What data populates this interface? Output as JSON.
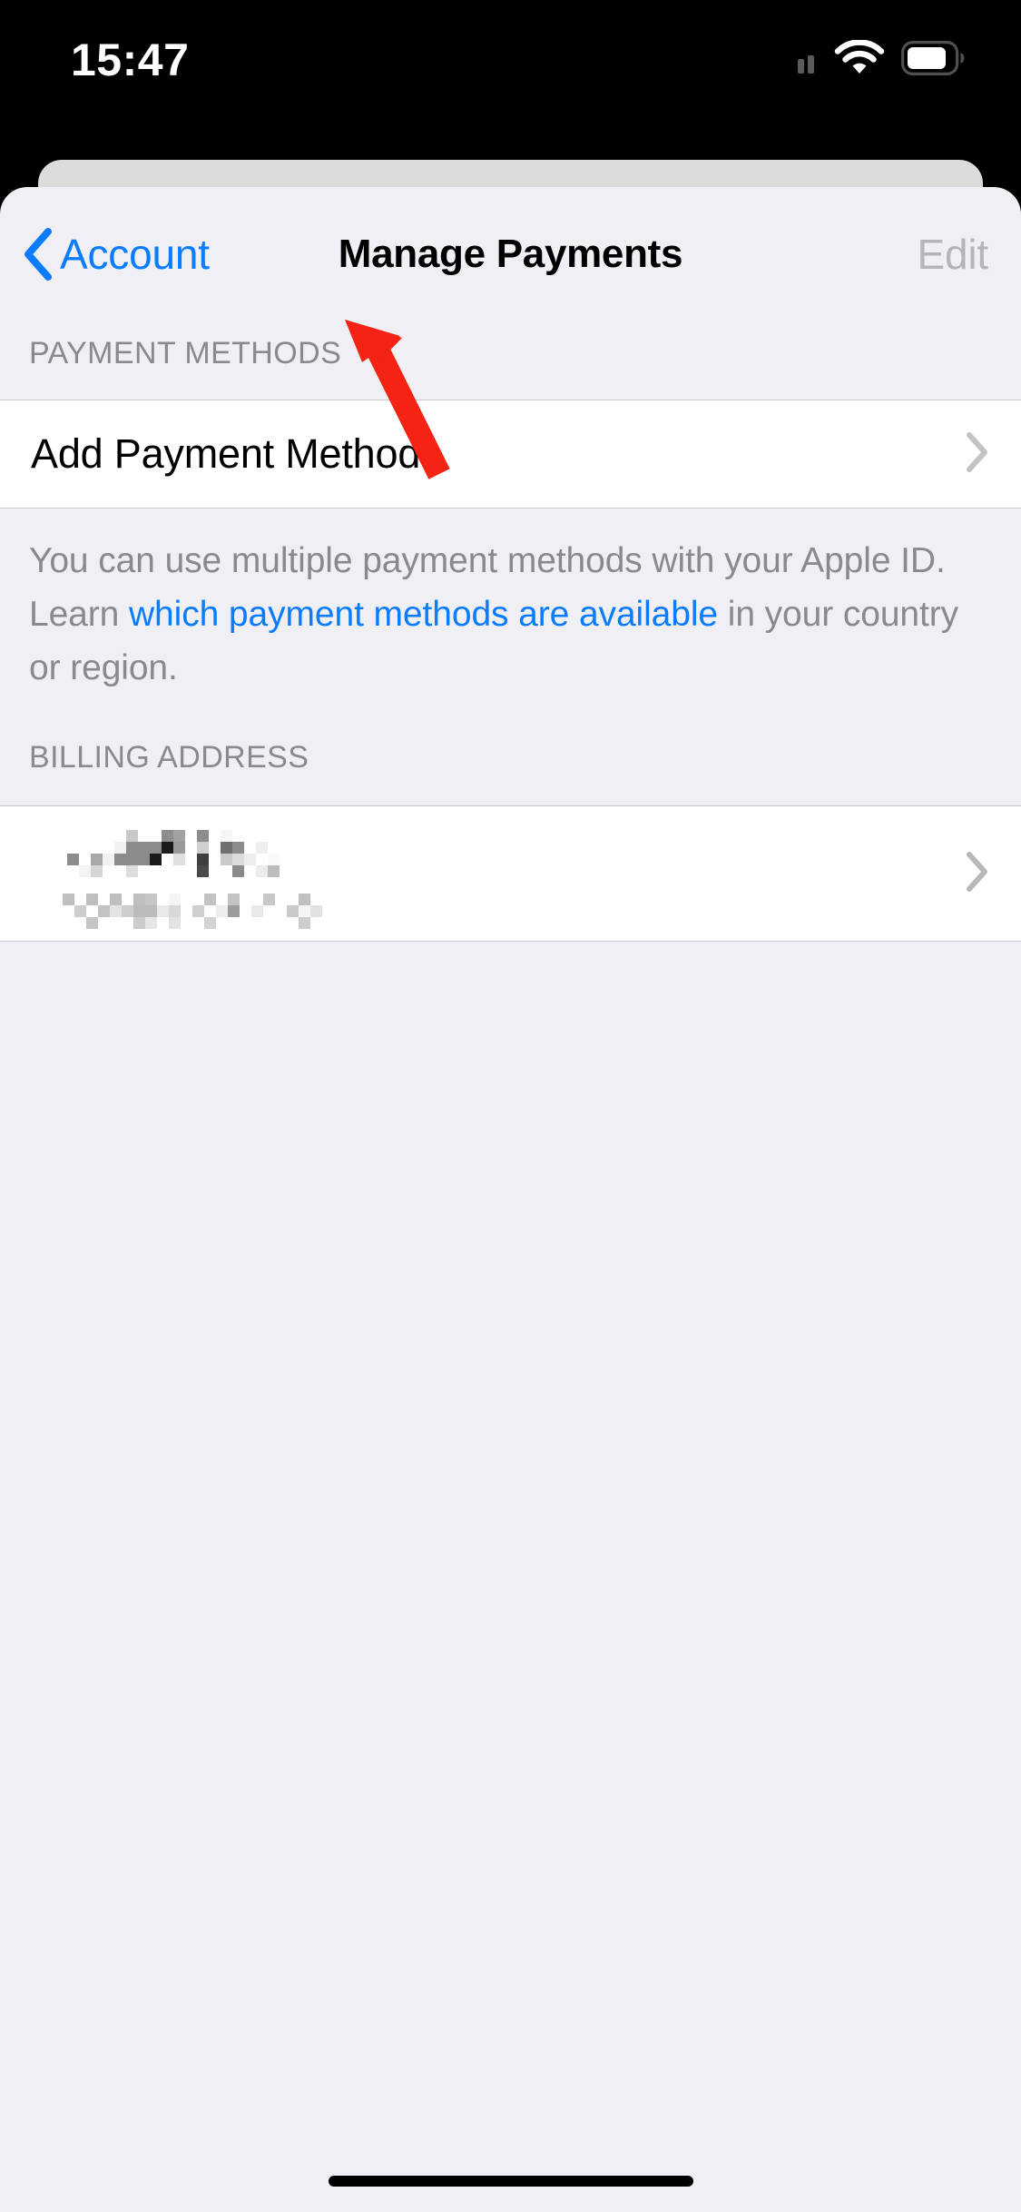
{
  "status_bar": {
    "time": "15:47",
    "icons": [
      "signal-bars-icon",
      "wifi-icon",
      "battery-icon"
    ]
  },
  "nav_bar": {
    "back_label": "Account",
    "back_icon": "chevron-left-icon",
    "title": "Manage Payments",
    "edit_label": "Edit",
    "edit_disabled": true
  },
  "sections": {
    "payment_methods": {
      "header": "PAYMENT METHODS",
      "rows": [
        {
          "title": "Add Payment Method",
          "accessory": "chevron-right-icon"
        }
      ],
      "footer": {
        "prefix": "You can use multiple payment methods with your Apple ID. Learn ",
        "link": "which payment methods are available",
        "suffix": " in your country or region."
      }
    },
    "billing_address": {
      "header": "BILLING ADDRESS",
      "rows": [
        {
          "title": "",
          "subtitle": "",
          "redacted": true,
          "accessory": "chevron-right-icon"
        }
      ]
    }
  },
  "annotation": {
    "type": "arrow",
    "color": "#f42314",
    "points_to": "Add Payment Method"
  },
  "colors": {
    "accent_blue": "#0a7cff",
    "group_background": "#f0f0f4",
    "cell_background": "#ffffff",
    "separator": "#c8c7cc",
    "secondary_label": "#8a8a8e",
    "disabled_label": "#b4b4b9",
    "annotation_red": "#f42314"
  },
  "home_indicator": {
    "visible": true
  }
}
